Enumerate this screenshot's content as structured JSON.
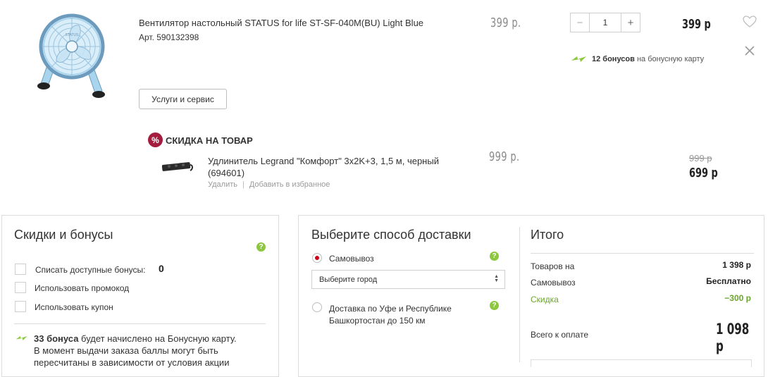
{
  "product1": {
    "title": "Вентилятор настольный STATUS for life ST-SF-040M(BU) Light Blue",
    "sku": "Арт. 590132398",
    "unit_price": "399 р.",
    "quantity": "1",
    "total_price": "399 р",
    "bonus_count": "12 бонусов",
    "bonus_text": "на бонусную карту",
    "service_button": "Услуги и сервис",
    "image_icon": "fan-image",
    "fan_color": "#a9d4ee"
  },
  "discount": {
    "badge": "%",
    "title": "СКИДКА НА ТОВАР",
    "badge_color": "#a41d3e"
  },
  "product2": {
    "title": "Удлинитель Legrand \"Комфорт\" 3x2K+3, 1,5 м, черный (694601)",
    "unit_price": "999 р.",
    "old_price": "999 р",
    "new_price": "699 р",
    "remove_link": "Удалить",
    "separator": "|",
    "favorite_link": "Добавить в избранное"
  },
  "discounts_panel": {
    "title": "Скидки и бонусы",
    "options": [
      {
        "label": "Списать доступные бонусы:",
        "value": "0"
      },
      {
        "label": "Использовать промокод"
      },
      {
        "label": "Использовать купон"
      }
    ],
    "bonus_count": "33 бонуса",
    "bonus_note_1": "будет начислено на Бонусную карту.",
    "bonus_note_2": "В момент выдачи заказа баллы могут быть",
    "bonus_note_3": "пересчитаны в зависимости от условия акции"
  },
  "delivery_panel": {
    "title": "Выберите способ доставки",
    "pickup_label": "Самовывоз",
    "city_placeholder": "Выберите город",
    "delivery_label_1": "Доставка по Уфе и Республике",
    "delivery_label_2": "Башкортостан до 150 км",
    "help_mark": "?"
  },
  "summary": {
    "title": "Итого",
    "goods_label": "Товаров на",
    "goods_value": "1 398 р",
    "pickup_label": "Самовывоз",
    "pickup_value": "Бесплатно",
    "discount_label": "Скидка",
    "discount_value": "−300 р",
    "total_label": "Всего к оплате",
    "total_value": "1 098 р"
  },
  "colors": {
    "accent_green": "#8dc63f",
    "discount_green": "#6aa52c",
    "radio_selected": "#d0021b"
  }
}
